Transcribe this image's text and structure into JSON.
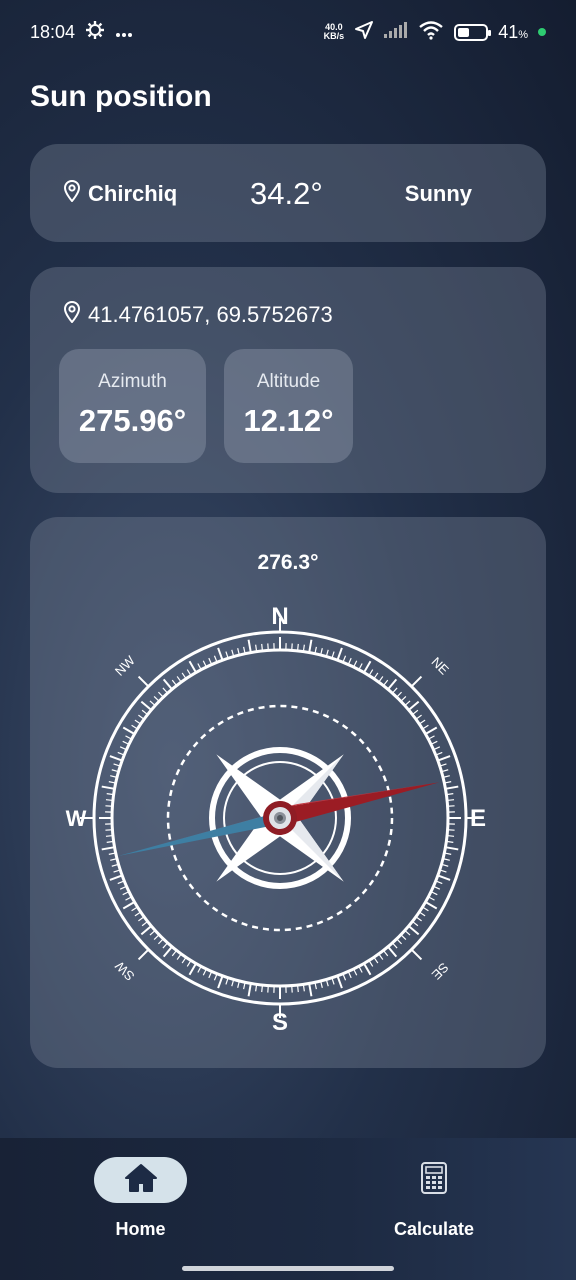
{
  "status_bar": {
    "time": "18:04",
    "net_speed_value": "40.0",
    "net_speed_unit": "KB/s",
    "battery_percent": "41",
    "battery_percent_sign": "%",
    "battery_level": 0.41
  },
  "page": {
    "title": "Sun position"
  },
  "summary": {
    "location": "Chirchiq",
    "temperature": "34.2°",
    "weather": "Sunny"
  },
  "position": {
    "coordinates": "41.4761057, 69.5752673",
    "azimuth_label": "Azimuth",
    "azimuth_value": "275.96°",
    "altitude_label": "Altitude",
    "altitude_value": "12.12°"
  },
  "compass": {
    "heading": "276.3°",
    "needle_angle_deg": 276.3,
    "labels": {
      "n": "N",
      "e": "E",
      "s": "S",
      "w": "W",
      "ne": "NE",
      "nw": "NW",
      "se": "SE",
      "sw": "SW"
    }
  },
  "nav": {
    "home_label": "Home",
    "calculate_label": "Calculate"
  },
  "colors": {
    "needle_red": "#9b1c24",
    "needle_blue": "#3e7fa3",
    "home_pill": "#d5e2ea",
    "status_green": "#2ecc71"
  }
}
